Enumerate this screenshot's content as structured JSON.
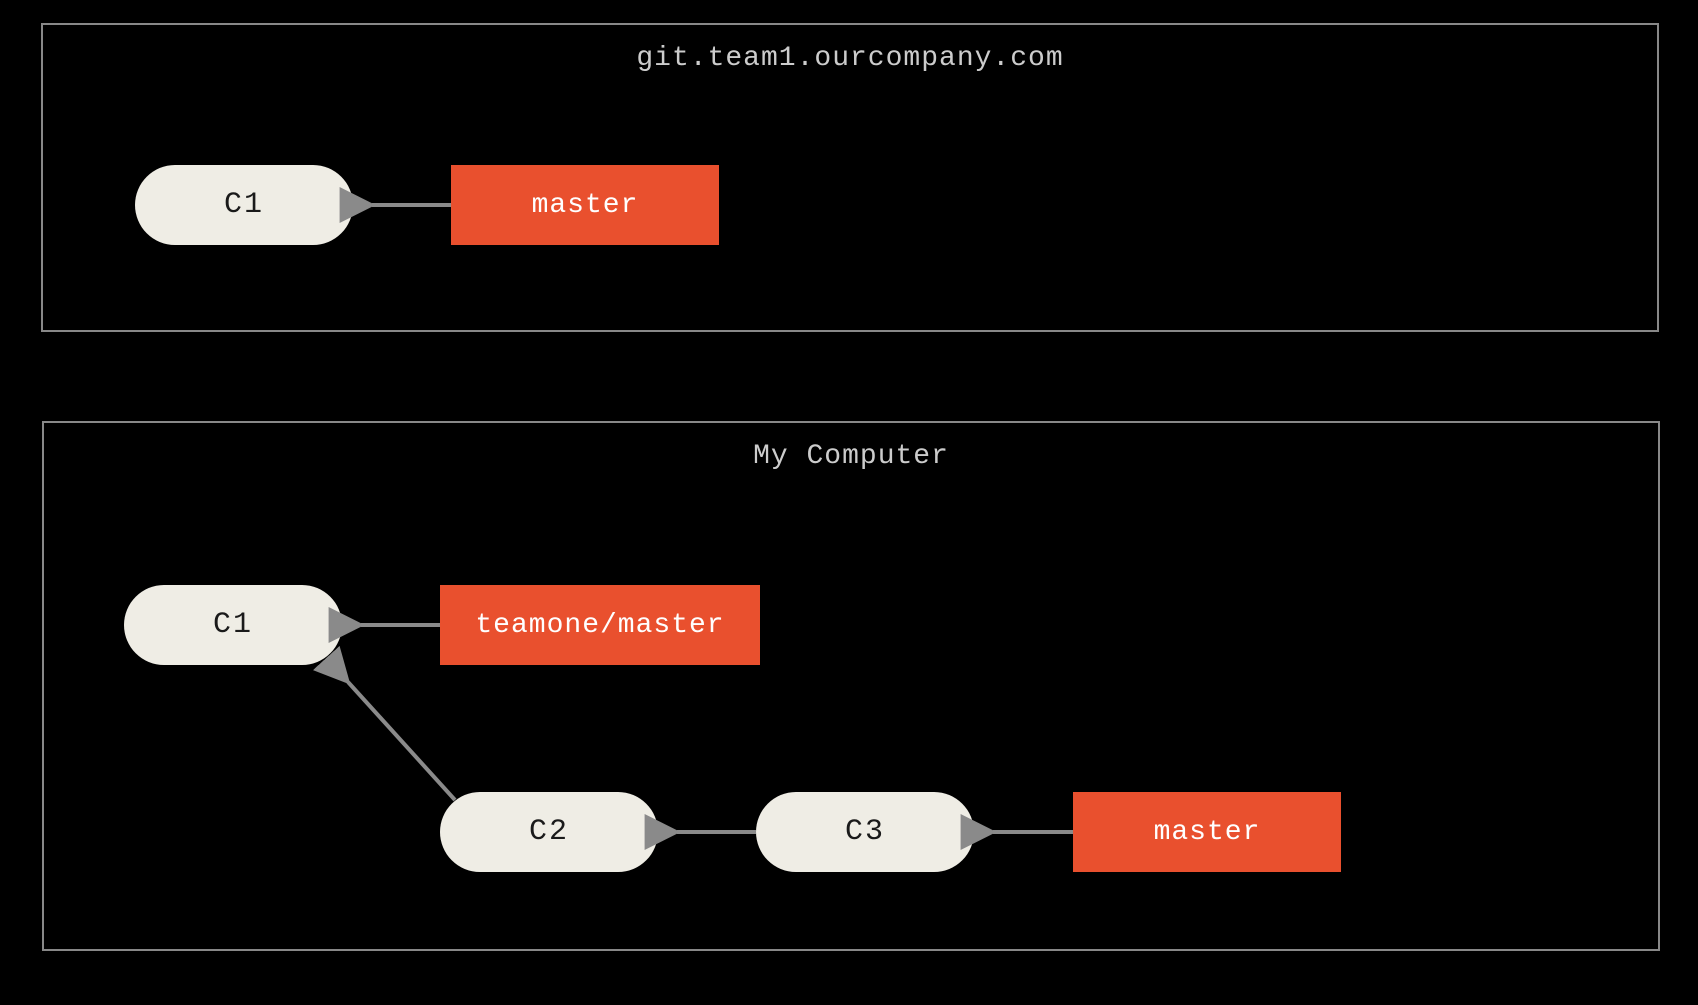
{
  "remote": {
    "title": "git.team1.ourcompany.com",
    "commit1": "C1",
    "branch_master": "master"
  },
  "local": {
    "title": "My Computer",
    "commit1": "C1",
    "commit2": "C2",
    "commit3": "C3",
    "branch_teamone": "teamone/master",
    "branch_master": "master"
  }
}
